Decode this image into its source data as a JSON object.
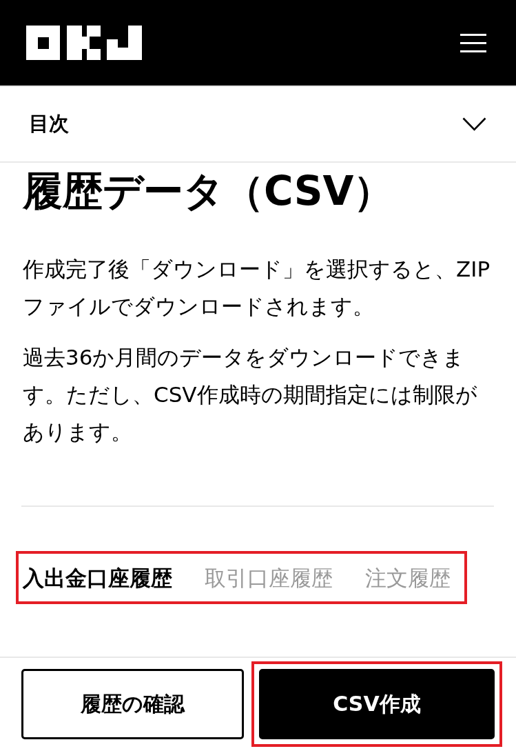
{
  "toc": {
    "label": "目次",
    "expanded": false
  },
  "title": "履歴データ（CSV）",
  "paragraphs": [
    "作成完了後「ダウンロード」を選択すると、ZIPファイルでダウンロードされます。",
    "過去36か月間のデータをダウンロードできます。ただし、CSV作成時の期間指定には制限があります。"
  ],
  "tabs": {
    "highlighted": true,
    "items": [
      {
        "label": "入出金口座履歴",
        "selected": true
      },
      {
        "label": "取引口座履歴",
        "selected": false
      },
      {
        "label": "注文履歴",
        "selected": false
      }
    ]
  },
  "buttons": [
    {
      "label": "履歴の確認",
      "kind": "outline",
      "highlighted": false
    },
    {
      "label": "CSV作成",
      "kind": "primary",
      "highlighted": true
    }
  ]
}
